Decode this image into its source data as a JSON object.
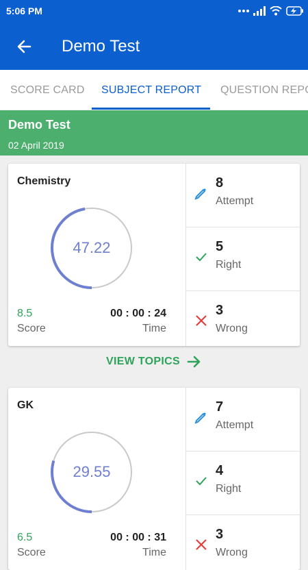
{
  "status_bar": {
    "time": "5:06 PM"
  },
  "header": {
    "title": "Demo Test"
  },
  "tabs": [
    {
      "label": "SCORE CARD"
    },
    {
      "label": "SUBJECT REPORT"
    },
    {
      "label": "QUESTION REPORT"
    }
  ],
  "test": {
    "name": "Demo Test",
    "date": "02 April 2019"
  },
  "subjects": [
    {
      "name": "Chemistry",
      "percent": "47.22",
      "score": "8.5",
      "score_label": "Score",
      "time": "00 : 00 : 24",
      "time_label": "Time",
      "attempt": "8",
      "attempt_label": "Attempt",
      "right": "5",
      "right_label": "Right",
      "wrong": "3",
      "wrong_label": "Wrong"
    },
    {
      "name": "GK",
      "percent": "29.55",
      "score": "6.5",
      "score_label": "Score",
      "time": "00 : 00 : 31",
      "time_label": "Time",
      "attempt": "7",
      "attempt_label": "Attempt",
      "right": "4",
      "right_label": "Right",
      "wrong": "3",
      "wrong_label": "Wrong"
    }
  ],
  "view_topics_label": "VIEW TOPICS",
  "colors": {
    "primary": "#0b5fcf",
    "banner": "#4caf6e",
    "accent_green": "#2ea35a",
    "ring": "#6f7fcf",
    "wrong": "#e53935"
  }
}
